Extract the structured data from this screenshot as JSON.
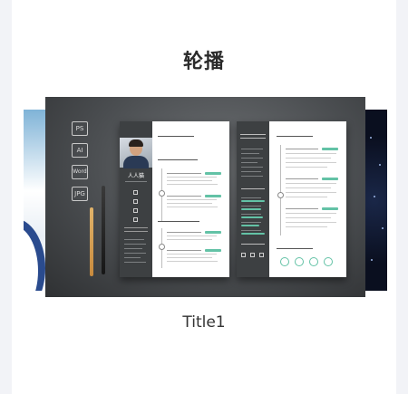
{
  "section": {
    "heading": "轮播"
  },
  "carousel": {
    "current_title": "Title1",
    "file_tags": [
      "PS",
      "AI",
      "Word",
      "JPG"
    ],
    "resume_name": "人人猫"
  },
  "colors": {
    "accent": "#63c2a6",
    "sidebar": "#3d4042"
  }
}
